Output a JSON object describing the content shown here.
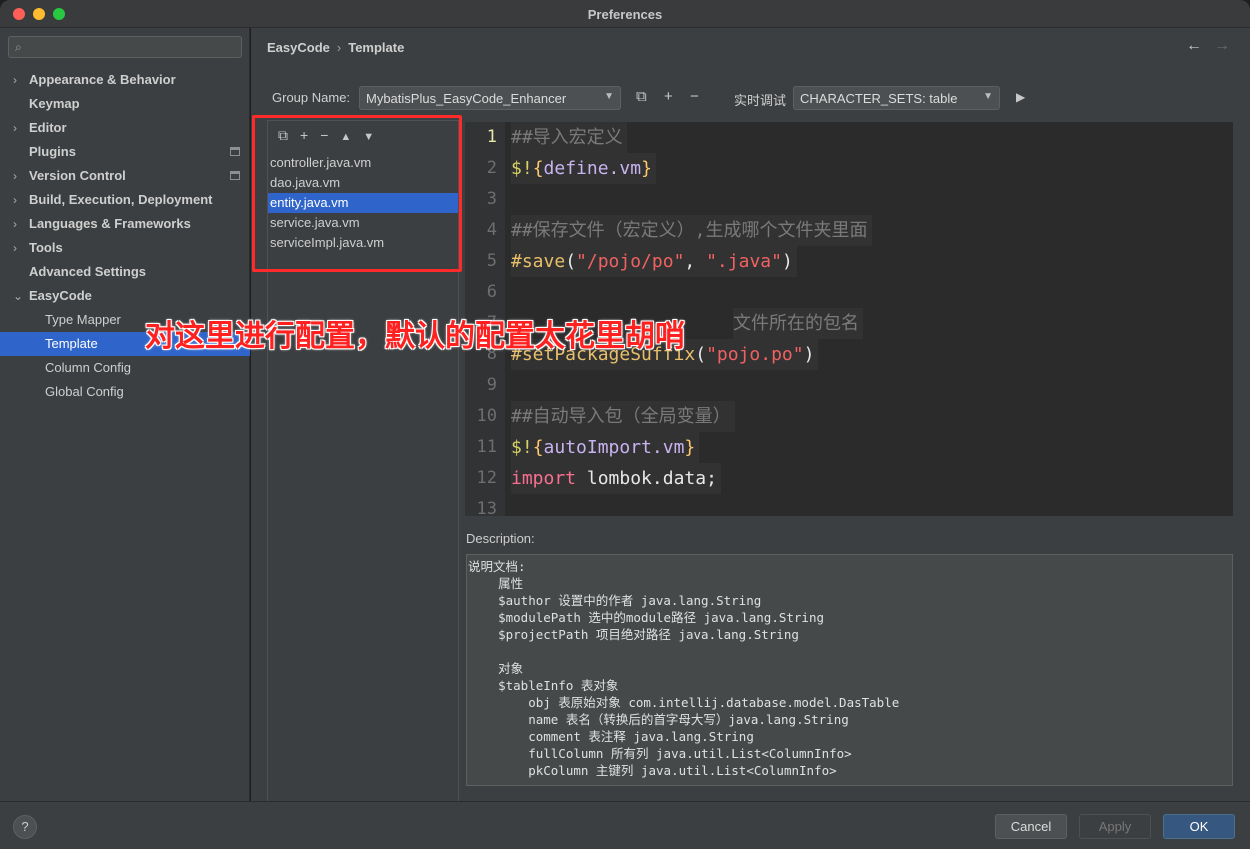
{
  "window": {
    "title": "Preferences"
  },
  "sidebar": {
    "search_placeholder": "",
    "items": [
      {
        "label": "Appearance & Behavior",
        "chevron": "›"
      },
      {
        "label": "Keymap"
      },
      {
        "label": "Editor",
        "chevron": "›"
      },
      {
        "label": "Plugins"
      },
      {
        "label": "Version Control",
        "chevron": "›"
      },
      {
        "label": "Build, Execution, Deployment",
        "chevron": "›"
      },
      {
        "label": "Languages & Frameworks",
        "chevron": "›"
      },
      {
        "label": "Tools",
        "chevron": "›"
      },
      {
        "label": "Advanced Settings"
      },
      {
        "label": "EasyCode",
        "chevron": "⌄"
      },
      {
        "label": "Type Mapper"
      },
      {
        "label": "Template"
      },
      {
        "label": "Column Config"
      },
      {
        "label": "Global Config"
      }
    ]
  },
  "header": {
    "breadcrumb": [
      "EasyCode",
      "Template"
    ],
    "separator": "›",
    "back_icon": "←",
    "forward_icon": "→"
  },
  "group": {
    "label": "Group Name:",
    "value": "MybatisPlus_EasyCode_Enhancer",
    "realtime_label": "实时调试",
    "charset_value": "CHARACTER_SETS: table",
    "icons": {
      "copy": "⧉",
      "add": "+",
      "remove": "−",
      "run": "▶"
    }
  },
  "files": {
    "toolbar": {
      "copy": "⧉",
      "add": "+",
      "remove": "−",
      "up": "▲",
      "down": "▼"
    },
    "items": [
      "controller.java.vm",
      "dao.java.vm",
      "entity.java.vm",
      "service.java.vm",
      "serviceImpl.java.vm"
    ]
  },
  "editor": {
    "lines": [
      {
        "n": "1",
        "text": "##导入宏定义"
      },
      {
        "n": "2",
        "text": "$!{define.vm}"
      },
      {
        "n": "3",
        "text": ""
      },
      {
        "n": "4",
        "text": "##保存文件（宏定义）,生成哪个文件夹里面"
      },
      {
        "n": "5",
        "text": "#save(\"/pojo/po\", \".java\")"
      },
      {
        "n": "6",
        "text": ""
      },
      {
        "n": "7",
        "text": "文件所在的包名"
      },
      {
        "n": "8",
        "text": "#setPackageSuffix(\"pojo.po\")"
      },
      {
        "n": "9",
        "text": ""
      },
      {
        "n": "10",
        "text": "##自动导入包（全局变量）"
      },
      {
        "n": "11",
        "text": "$!{autoImport.vm}"
      },
      {
        "n": "12",
        "text": "import lombok.data;"
      },
      {
        "n": "13",
        "text": ""
      }
    ]
  },
  "description": {
    "label": "Description:",
    "lines": [
      "说明文档:",
      "    属性",
      "    $author 设置中的作者 java.lang.String",
      "    $modulePath 选中的module路径 java.lang.String",
      "    $projectPath 项目绝对路径 java.lang.String",
      "",
      "    对象",
      "    $tableInfo 表对象",
      "        obj 表原始对象 com.intellij.database.model.DasTable",
      "        name 表名（转换后的首字母大写）java.lang.String",
      "        comment 表注释 java.lang.String",
      "        fullColumn 所有列 java.util.List<ColumnInfo>",
      "        pkColumn 主键列 java.util.List<ColumnInfo>"
    ]
  },
  "annotation": {
    "text": "对这里进行配置，默认的配置太花里胡哨"
  },
  "footer": {
    "help": "?",
    "cancel": "Cancel",
    "apply": "Apply",
    "ok": "OK"
  }
}
